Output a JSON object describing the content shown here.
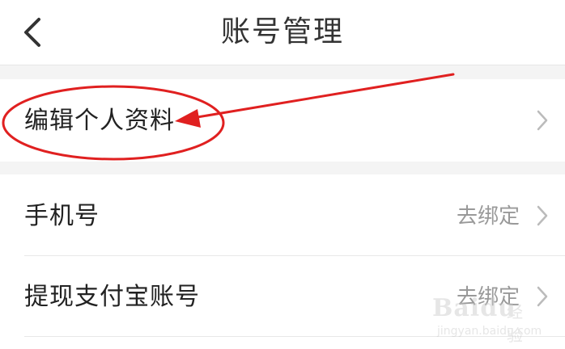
{
  "header": {
    "title": "账号管理"
  },
  "groups": [
    {
      "rows": [
        {
          "label": "编辑个人资料",
          "value": ""
        }
      ]
    },
    {
      "rows": [
        {
          "label": "手机号",
          "value": "去绑定"
        },
        {
          "label": "提现支付宝账号",
          "value": "去绑定"
        }
      ]
    }
  ],
  "annotation": {
    "color": "#e02020",
    "shapes": [
      "ellipse",
      "arrow"
    ]
  },
  "watermark": {
    "brand": "Baidu",
    "sub": "经验",
    "url": "jingyan.baidu.com"
  },
  "icons": {
    "back": "chevron-left-icon",
    "row_arrow": "chevron-right-icon"
  }
}
